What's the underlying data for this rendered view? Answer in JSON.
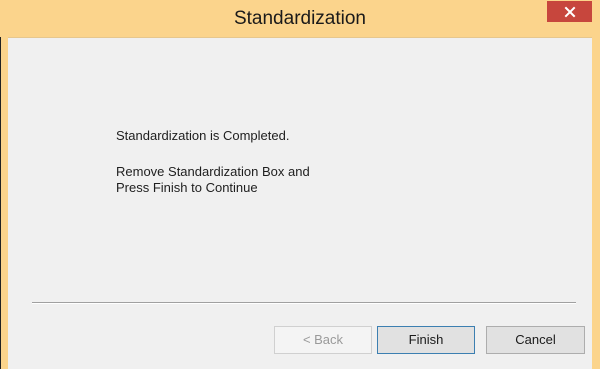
{
  "window": {
    "title": "Standardization",
    "frame_color": "#fbd48c",
    "close_color": "#c7463d",
    "close_icon": "close-icon"
  },
  "content": {
    "status_message": "Standardization is Completed.",
    "instruction_line_1": "Remove Standardization Box and",
    "instruction_line_2": "Press Finish to Continue"
  },
  "buttons": {
    "back": {
      "label": "< Back",
      "enabled": false
    },
    "finish": {
      "label": "Finish",
      "enabled": true,
      "default": true
    },
    "cancel": {
      "label": "Cancel",
      "enabled": true
    }
  }
}
